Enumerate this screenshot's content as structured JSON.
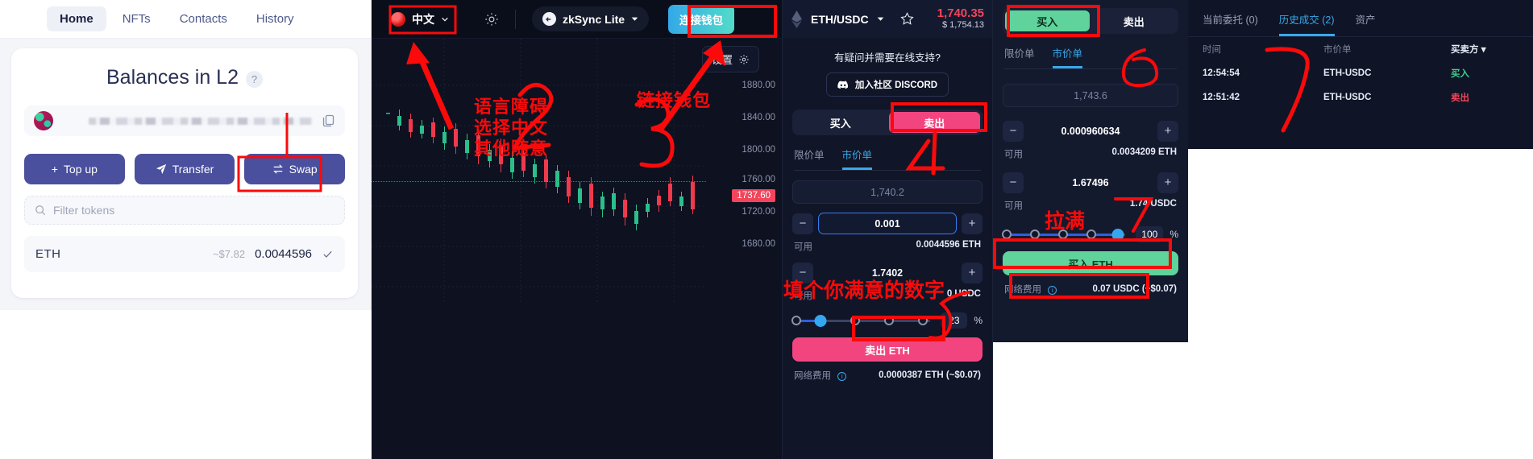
{
  "wallet": {
    "tabs": [
      {
        "label": "Home",
        "active": true
      },
      {
        "label": "NFTs",
        "active": false
      },
      {
        "label": "Contacts",
        "active": false
      },
      {
        "label": "History",
        "active": false
      }
    ],
    "title": "Balances in L2",
    "help_badge": "?",
    "buttons": {
      "topup": "Top up",
      "transfer": "Transfer",
      "swap": "Swap"
    },
    "filter_placeholder": "Filter tokens",
    "token": {
      "symbol": "ETH",
      "usd": "~$7.82",
      "amount": "0.0044596"
    }
  },
  "exchange": {
    "language": "中文",
    "network": "zkSync Lite",
    "connect_wallet": "连接钱包",
    "settings": "设置",
    "chart": {
      "axis_labels": [
        "1880.00",
        "1840.00",
        "1800.00",
        "1760.00",
        "1720.00",
        "1680.00"
      ],
      "current_price": "1737.60"
    }
  },
  "annotations": {
    "lang_note": [
      "语言障碍",
      "选择中文",
      "其他随意"
    ],
    "connect_note": "链接钱包",
    "amount_note": "填个你满意的数字",
    "max_note": "拉满",
    "marks": {
      "two": "2",
      "three": "3",
      "four": "4",
      "five": "5",
      "six": "6",
      "seven": "7"
    }
  },
  "sell_panel": {
    "pair": "ETH/USDC",
    "price": "1,740.35",
    "price_usd": "$ 1,754.13",
    "support_text": "有疑问并需要在线支持?",
    "discord_label": "加入社区 DISCORD",
    "buy_tab": "买入",
    "sell_tab": "卖出",
    "limit_tab": "限价单",
    "market_tab": "市价单",
    "market_price": "1,740.2",
    "amount": "0.001",
    "available_label": "可用",
    "available_amount": "0.0044596 ETH",
    "total": "1.7402",
    "available_label2": "可用",
    "available_quote": "0 USDC",
    "percent": "23",
    "percent_sign": "%",
    "action": "卖出 ETH",
    "fee_label": "网络费用",
    "fee_value": "0.0000387 ETH (~$0.07)"
  },
  "buy_panel": {
    "buy_tab": "买入",
    "sell_tab": "卖出",
    "limit_tab": "限价单",
    "market_tab": "市价单",
    "market_price": "1,743.6",
    "amount": "0.000960634",
    "available_label": "可用",
    "available_amount": "0.0034209 ETH",
    "total": "1.67496",
    "available_label2": "可用",
    "available_quote": "1.74 USDC",
    "percent": "100",
    "percent_sign": "%",
    "action": "买入 ETH",
    "fee_label": "网络费用",
    "fee_value": "0.07 USDC (~$0.07)"
  },
  "history": {
    "tabs": [
      {
        "label": "当前委托 (0)",
        "active": false
      },
      {
        "label": "历史成交 (2)",
        "active": true
      },
      {
        "label": "资产",
        "active": false
      }
    ],
    "columns": [
      "时间",
      "市价单",
      "买卖方"
    ],
    "rows": [
      {
        "time": "12:54:54",
        "pair": "ETH-USDC",
        "side": "买入",
        "side_type": "buy"
      },
      {
        "time": "12:51:42",
        "pair": "ETH-USDC",
        "side": "卖出",
        "side_type": "sell"
      }
    ]
  },
  "colors": {
    "accent_blue": "#39a9e8",
    "sell_pink": "#f2457f",
    "buy_green": "#5fd39b",
    "annotation_red": "#fa0a0a",
    "wallet_blue": "#4a4f9e"
  }
}
